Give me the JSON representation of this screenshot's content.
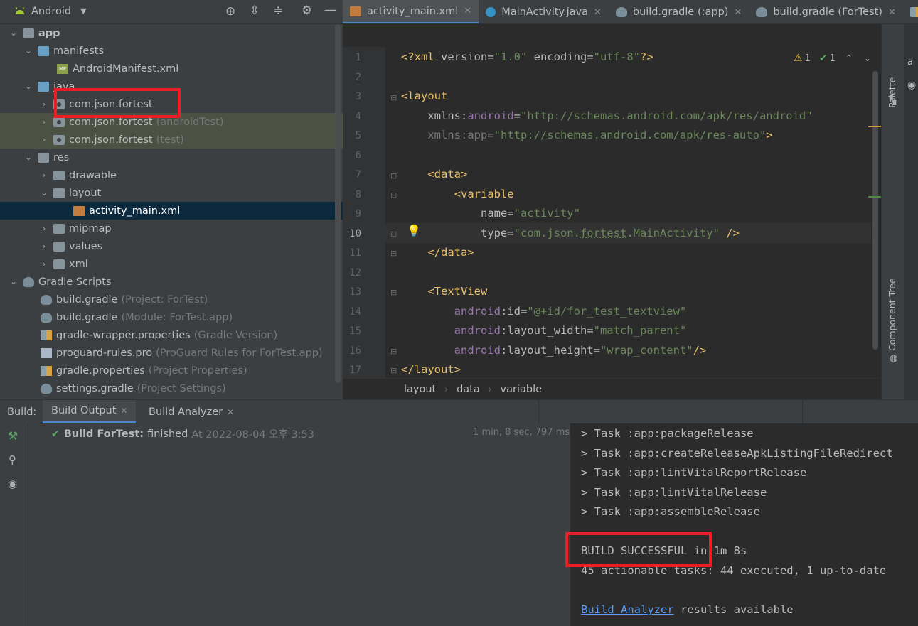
{
  "project": {
    "view_label": "Android",
    "tree": [
      {
        "label": "app",
        "hint": ""
      },
      {
        "label": "manifests",
        "hint": ""
      },
      {
        "label": "AndroidManifest.xml",
        "hint": ""
      },
      {
        "label": "java",
        "hint": ""
      },
      {
        "label": "com.json.fortest",
        "hint": ""
      },
      {
        "label": "com.json.fortest",
        "hint": "(androidTest)"
      },
      {
        "label": "com.json.fortest",
        "hint": "(test)"
      },
      {
        "label": "res",
        "hint": ""
      },
      {
        "label": "drawable",
        "hint": ""
      },
      {
        "label": "layout",
        "hint": ""
      },
      {
        "label": "activity_main.xml",
        "hint": ""
      },
      {
        "label": "mipmap",
        "hint": ""
      },
      {
        "label": "values",
        "hint": ""
      },
      {
        "label": "xml",
        "hint": ""
      },
      {
        "label": "Gradle Scripts",
        "hint": ""
      },
      {
        "label": "build.gradle",
        "hint": "(Project: ForTest)"
      },
      {
        "label": "build.gradle",
        "hint": "(Module: ForTest.app)"
      },
      {
        "label": "gradle-wrapper.properties",
        "hint": "(Gradle Version)"
      },
      {
        "label": "proguard-rules.pro",
        "hint": "(ProGuard Rules for ForTest.app)"
      },
      {
        "label": "gradle.properties",
        "hint": "(Project Properties)"
      },
      {
        "label": "settings.gradle",
        "hint": "(Project Settings)"
      }
    ]
  },
  "tabs": [
    {
      "label": "activity_main.xml"
    },
    {
      "label": "MainActivity.java"
    },
    {
      "label": "build.gradle (:app)"
    },
    {
      "label": "build.gradle (ForTest)"
    },
    {
      "label": "gra"
    }
  ],
  "editor": {
    "line_numbers": [
      "1",
      "2",
      "3",
      "4",
      "5",
      "6",
      "7",
      "8",
      "9",
      "10",
      "11",
      "12",
      "13",
      "14",
      "15",
      "16",
      "17"
    ],
    "inspection_warnings": "1",
    "inspection_ok": "1",
    "breadcrumb": [
      "layout",
      "data",
      "variable"
    ]
  },
  "side_tools": {
    "palette": "Palette",
    "component_tree": "Component Tree",
    "top_cut": "a"
  },
  "build": {
    "label": "Build:",
    "tab_output": "Build Output",
    "tab_analyzer": "Build Analyzer",
    "status_name": "Build ForTest:",
    "status_text": "finished",
    "status_time": "At 2022-08-04 오후 3:53",
    "duration": "1 min, 8 sec, 797 ms",
    "console": [
      "> Task :app:packageRelease",
      "> Task :app:createReleaseApkListingFileRedirect",
      "> Task :app:lintVitalReportRelease",
      "> Task :app:lintVitalRelease",
      "> Task :app:assembleRelease",
      "",
      "BUILD SUCCESSFUL in 1m 8s",
      "45 actionable tasks: 44 executed, 1 up-to-date",
      ""
    ],
    "analyzer_link": "Build Analyzer",
    "analyzer_suffix": " results available"
  },
  "colors": {
    "accent": "#4a88c7",
    "highlight_box": "#ee1c25",
    "success": "#59a869"
  }
}
